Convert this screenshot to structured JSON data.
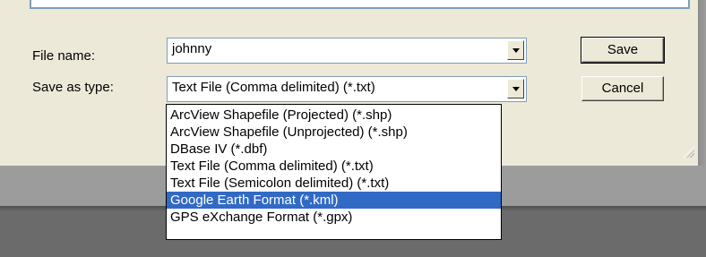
{
  "file_name": {
    "label": "File name:",
    "value": "johnny"
  },
  "save_as_type": {
    "label": "Save as type:",
    "value": "Text File (Comma delimited) (*.txt)",
    "options": [
      "ArcView Shapefile (Projected) (*.shp)",
      "ArcView Shapefile (Unprojected) (*.shp)",
      "DBase IV (*.dbf)",
      "Text File (Comma delimited) (*.txt)",
      "Text File (Semicolon delimited) (*.txt)",
      "Google Earth Format (*.kml)",
      "GPS eXchange Format (*.gpx)"
    ],
    "highlighted_option": "Google Earth Format (*.kml)"
  },
  "buttons": {
    "save": "Save",
    "cancel": "Cancel"
  },
  "icons": {
    "combo_arrow": "chevron-down-icon",
    "resize_grip": "resize-grip-icon"
  },
  "colors": {
    "dialog_bg": "#ece9d8",
    "selection": "#316ac5",
    "border": "#7f9db9"
  }
}
